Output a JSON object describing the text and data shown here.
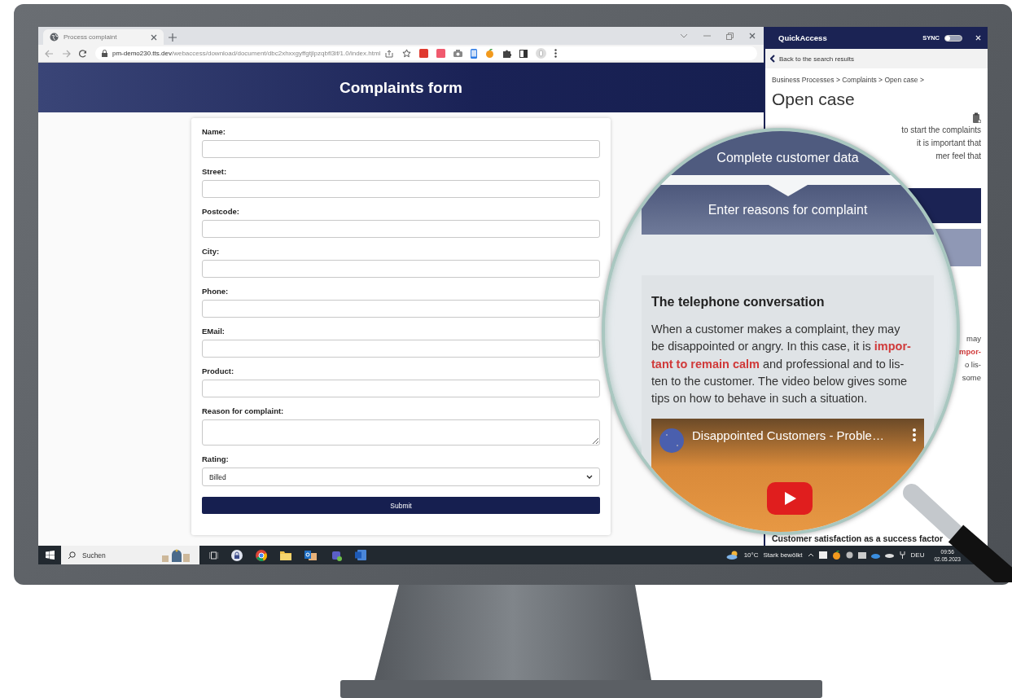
{
  "browser": {
    "tab": {
      "title": "Process complaint",
      "selected": true
    },
    "url_host": "pm-demo230.tts.dev",
    "url_path": "/webaccess/download/document/dbc2xhxxgyffgtjlpzqbfl3if/1.0/index.html"
  },
  "form": {
    "title": "Complaints form",
    "fields": [
      {
        "label": "Name:",
        "kind": "text"
      },
      {
        "label": "Street:",
        "kind": "text"
      },
      {
        "label": "Postcode:",
        "kind": "text"
      },
      {
        "label": "City:",
        "kind": "text"
      },
      {
        "label": "Phone:",
        "kind": "text"
      },
      {
        "label": "EMail:",
        "kind": "text"
      },
      {
        "label": "Product:",
        "kind": "text"
      },
      {
        "label": "Reason for complaint:",
        "kind": "textarea"
      },
      {
        "label": "Rating:",
        "kind": "select",
        "value": "Billed"
      }
    ],
    "submit": "Submit"
  },
  "quick_access": {
    "title": "QuickAccess",
    "sync_label": "SYNC",
    "sync_on": false,
    "back": "Back to the search results",
    "breadcrumb": "Business Processes > Complaints > Open case >",
    "heading": "Open case",
    "fragments_top": [
      "to start the complaints",
      "it is important that",
      "mer feel that"
    ],
    "fragments_side": [
      {
        "text": "may",
        "kind": "plain"
      },
      {
        "text": "mpor-",
        "kind": "emphasis"
      },
      {
        "text": "o lis-",
        "kind": "plain"
      },
      {
        "text": "some",
        "kind": "plain"
      }
    ],
    "footer_heading": "Customer satisfaction as a success factor"
  },
  "magnifier": {
    "steps": [
      "Complete customer data",
      "Enter reasons for complaint"
    ],
    "card_heading": "The telephone conversation",
    "card_text": "When a customer makes a complaint, they may\nbe disappointed or angry. In this case, it is **impor-**\n**tant to remain calm** and professional and to lis-\nten to the customer. The video below gives some\ntips on how to behave in such a situation.",
    "video_title": "Disappointed Customers - Proble…"
  },
  "taskbar": {
    "search_placeholder": "Suchen",
    "temperature": "10°C",
    "weather": "Stark bewölkt",
    "language": "DEU",
    "time": "09:56",
    "date": "02.05.2023"
  }
}
